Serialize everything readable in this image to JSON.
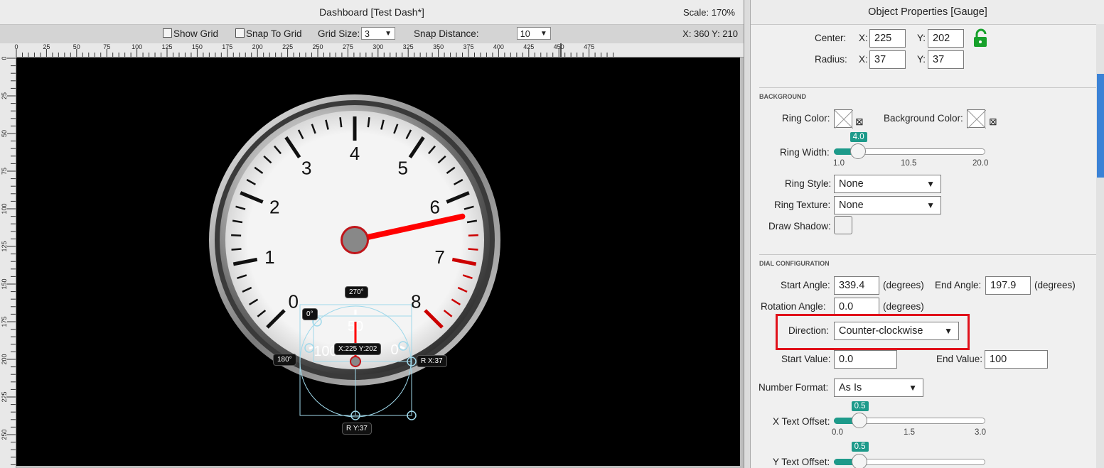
{
  "dashboard": {
    "title": "Dashboard [Test Dash*]",
    "scale": "Scale: 170%",
    "coords": "X: 360 Y: 210",
    "toolbar": {
      "show_grid": "Show Grid",
      "snap_to_grid": "Snap To Grid",
      "grid_size_label": "Grid Size:",
      "grid_size_value": "3",
      "snap_distance_label": "Snap Distance:",
      "snap_distance_value": "10"
    },
    "ruler_top": [
      "0",
      "25",
      "50",
      "75",
      "100",
      "125",
      "150",
      "175",
      "200",
      "225",
      "250",
      "275",
      "300",
      "325",
      "350",
      "375",
      "400",
      "425",
      "450",
      "475"
    ],
    "ruler_left": [
      "0",
      "25",
      "50",
      "75",
      "100",
      "125",
      "150",
      "175",
      "200",
      "225",
      "250"
    ],
    "gauge": {
      "dial_labels": [
        "0",
        "1",
        "2",
        "3",
        "4",
        "5",
        "6",
        "7",
        "8"
      ],
      "needle_value": 6.3,
      "red_from": 6.5
    },
    "mini_gauge": {
      "labels": {
        "top": "50",
        "left": "100",
        "right": "0"
      },
      "tags": {
        "angle_270": "270°",
        "angle_0": "0°",
        "angle_180": "180°",
        "center": "X:225 Y:202",
        "radius_x": "R X:37",
        "radius_y": "R Y:37"
      }
    },
    "colors": {
      "needle": "#ff0000",
      "redline": "#cc0000",
      "selection": "#9fd8ea"
    }
  },
  "properties": {
    "title": "Object Properties [Gauge]",
    "center": {
      "label": "Center:",
      "x_label": "X:",
      "x": "225",
      "y_label": "Y:",
      "y": "202"
    },
    "radius": {
      "label": "Radius:",
      "x_label": "X:",
      "x": "37",
      "y_label": "Y:",
      "y": "37"
    },
    "background_section": "BACKGROUND",
    "ring_color_label": "Ring Color:",
    "background_color_label": "Background Color:",
    "ring_width": {
      "label": "Ring Width:",
      "value": "4.0",
      "min": "1.0",
      "mid": "10.5",
      "max": "20.0",
      "fraction": 0.158
    },
    "ring_style": {
      "label": "Ring Style:",
      "value": "None"
    },
    "ring_texture": {
      "label": "Ring Texture:",
      "value": "None"
    },
    "draw_shadow_label": "Draw Shadow:",
    "dial_section": "DIAL CONFIGURATION",
    "start_angle": {
      "label": "Start Angle:",
      "value": "339.4",
      "unit": "(degrees)"
    },
    "end_angle": {
      "label": "End Angle:",
      "value": "197.9",
      "unit": "(degrees)"
    },
    "rotation_angle": {
      "label": "Rotation Angle:",
      "value": "0.0",
      "unit": "(degrees)"
    },
    "direction": {
      "label": "Direction:",
      "value": "Counter-clockwise"
    },
    "start_value": {
      "label": "Start Value:",
      "value": "0.0"
    },
    "end_value": {
      "label": "End Value:",
      "value": "100"
    },
    "number_format": {
      "label": "Number Format:",
      "value": "As Is"
    },
    "x_text_offset": {
      "label": "X Text Offset:",
      "value": "0.5",
      "min": "0.0",
      "mid": "1.5",
      "max": "3.0",
      "fraction": 0.167
    },
    "y_text_offset": {
      "label": "Y Text Offset:",
      "value": "0.5"
    },
    "colors": {
      "accent": "#1d9a8a",
      "lock": "#17a12b",
      "highlight": "#e0101a",
      "scroll": "#3b82d6"
    }
  }
}
